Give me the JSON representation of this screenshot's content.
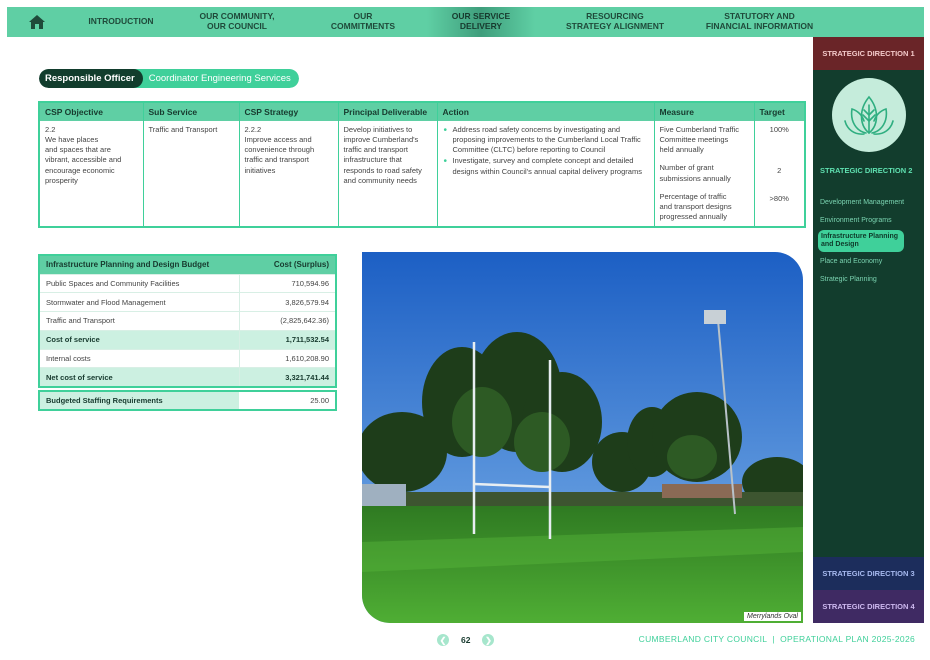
{
  "nav": {
    "home_icon": "home-icon",
    "items": [
      {
        "label": "INTRODUCTION",
        "active": false
      },
      {
        "label": "OUR COMMUNITY,\nOUR COUNCIL",
        "active": false
      },
      {
        "label": "OUR\nCOMMITMENTS",
        "active": false
      },
      {
        "label": "OUR SERVICE\nDELIVERY",
        "active": true
      },
      {
        "label": "RESOURCING\nSTRATEGY ALIGNMENT",
        "active": false
      },
      {
        "label": "STATUTORY AND\nFINANCIAL INFORMATION",
        "active": false
      }
    ]
  },
  "sidebar": {
    "direction1": "STRATEGIC DIRECTION 1",
    "direction2": "STRATEGIC DIRECTION 2",
    "direction2_icon": "lotus-leaf-icon",
    "items": [
      {
        "label": "Development Management",
        "active": false
      },
      {
        "label": "Environment Programs",
        "active": false
      },
      {
        "label": "Infrastructure Planning and Design",
        "active": true
      },
      {
        "label": "Place and Economy",
        "active": false
      },
      {
        "label": "Strategic Planning",
        "active": false
      }
    ],
    "direction3": "STRATEGIC DIRECTION 3",
    "direction4": "STRATEGIC DIRECTION 4"
  },
  "officer": {
    "label": "Responsible Officer",
    "value": "Coordinator Engineering Services"
  },
  "csp_table": {
    "headers": [
      "CSP Objective",
      "Sub Service",
      "CSP Strategy",
      "Principal Deliverable",
      "Action",
      "Measure",
      "Target"
    ],
    "objective": "2.2\nWe have places\nand spaces that are\nvibrant, accessible and\nencourage economic\nprosperity",
    "sub_service": "Traffic and Transport",
    "strategy": "2.2.2\nImprove access and\nconvenience through\ntraffic and transport\ninitiatives",
    "deliverable": "Develop initiatives to\nimprove Cumberland's\ntraffic and transport\ninfrastructure that\nresponds to road safety\nand community needs",
    "actions": [
      "Address road safety concerns by investigating and proposing improvements to the Cumberland Local Traffic Committee (CLTC) before reporting to Council",
      "Investigate, survey and complete concept and detailed designs within Council's annual capital delivery programs"
    ],
    "measures": [
      "Five Cumberland Traffic\nCommittee meetings\nheld annually",
      "Number of grant\nsubmissions annually",
      "Percentage of traffic\nand transport designs\nprogressed annually"
    ],
    "targets": [
      "100%",
      "2",
      ">80%"
    ]
  },
  "budget": {
    "header_label": "Infrastructure Planning and Design Budget",
    "header_value": "Cost (Surplus)",
    "rows": [
      {
        "label": "Public Spaces and Community Facilities",
        "value": "710,594.96",
        "total": false
      },
      {
        "label": "Stormwater and Flood Management",
        "value": "3,826,579.94",
        "total": false
      },
      {
        "label": "Traffic and Transport",
        "value": "(2,825,642.36)",
        "total": false
      },
      {
        "label": "Cost of service",
        "value": "1,711,532.54",
        "total": true
      },
      {
        "label": "Internal costs",
        "value": "1,610,208.90",
        "total": false
      },
      {
        "label": "Net cost of service",
        "value": "3,321,741.44",
        "total": true
      }
    ]
  },
  "staffing": {
    "label": "Budgeted Staffing Requirements",
    "value": "25.00"
  },
  "photo": {
    "caption": "Merrylands Oval"
  },
  "footer": {
    "page_number": "62",
    "text": "CUMBERLAND CITY COUNCIL  |  OPERATIONAL PLAN 2025-2026"
  },
  "colors": {
    "accent": "#3fd09a",
    "nav_bg": "#5fcfa4",
    "dark_green": "#123d2d",
    "direction1": "#6a2528",
    "direction3": "#1c2d5c",
    "direction4": "#3f2a63"
  }
}
